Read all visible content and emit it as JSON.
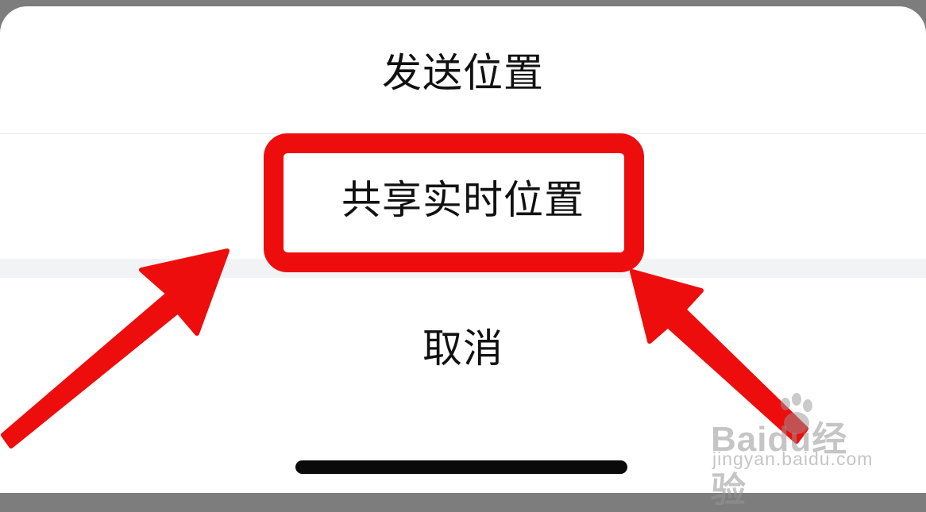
{
  "action_sheet": {
    "send_location_label": "发送位置",
    "share_live_location_label": "共享实时位置",
    "cancel_label": "取消"
  },
  "watermark": {
    "brand": "Baidu",
    "suffix": "经验",
    "url": "jingyan.baidu.com"
  },
  "colors": {
    "highlight": "#ee0d0d",
    "backdrop": "#7d7d7d",
    "separator_gap": "#f2f3f5"
  }
}
